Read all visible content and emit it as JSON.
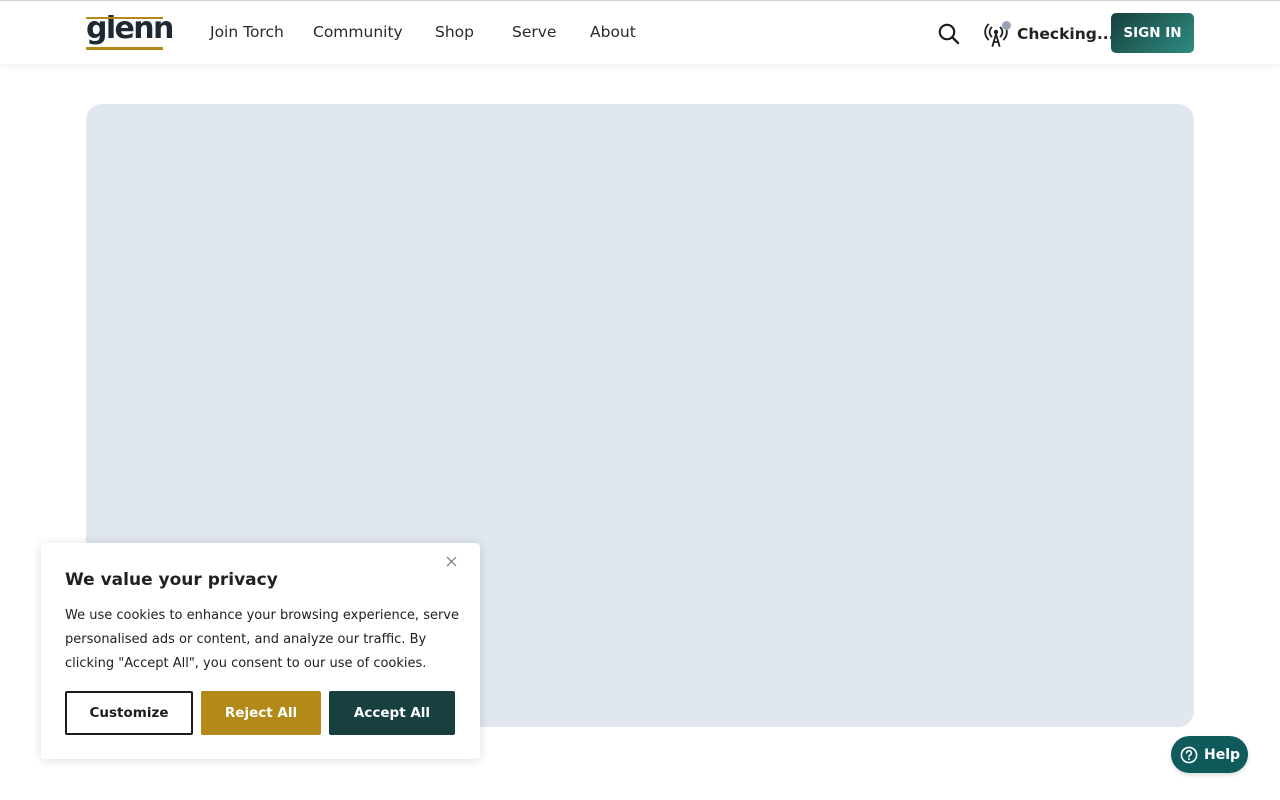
{
  "colors": {
    "brand_dark": "#17403f",
    "brand_teal": "#2f8c80",
    "gold": "#b38a1a",
    "hero_placeholder": "#e0e7ef",
    "status_dot": "#9aa3b5",
    "help_bg": "#0f5b5b"
  },
  "header": {
    "logo_text": "glenn",
    "nav": [
      "Join Torch",
      "Community",
      "Shop",
      "Serve",
      "About"
    ],
    "search_icon": "search-icon",
    "status_icon": "broadcast-antenna-icon",
    "status_text": "Checking...",
    "signin_label": "SIGN IN"
  },
  "cookie_banner": {
    "title": "We value your privacy",
    "body": "We use cookies to enhance your browsing experience, serve personalised ads or content, and analyze our traffic. By clicking \"Accept All\", you consent to our use of cookies.",
    "close_icon": "close-icon",
    "buttons": {
      "customize": "Customize",
      "reject": "Reject All",
      "accept": "Accept All"
    }
  },
  "help": {
    "icon": "question-circle-icon",
    "label": "Help"
  }
}
